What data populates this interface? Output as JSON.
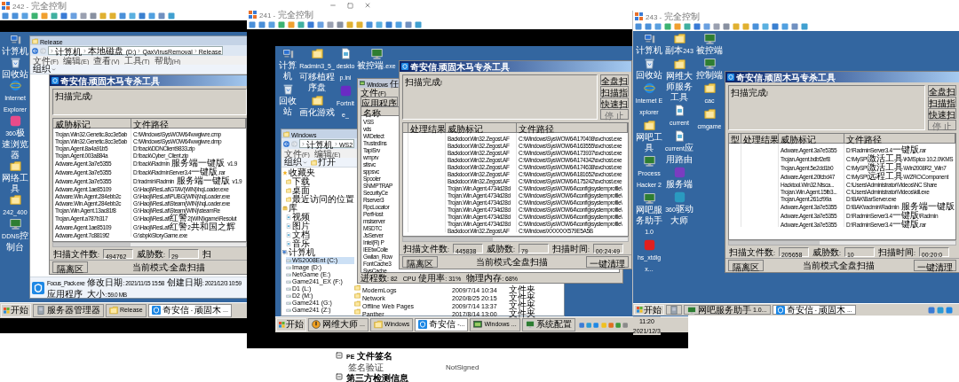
{
  "windows": [
    {
      "title": "242 - 完全控制",
      "desktop_icon_columns": [
        [
          {
            "kind": "computer",
            "label": "计算机"
          },
          {
            "kind": "recycle",
            "label": "回收站"
          },
          {
            "kind": "ie",
            "label": "Internet Explorer"
          },
          {
            "kind": "app",
            "color": "#e84b8a",
            "label": "360极速浏览器"
          },
          {
            "kind": "folder",
            "label": "网络工具"
          },
          {
            "kind": "folder",
            "label": "242_400"
          },
          {
            "kind": "monitor",
            "label": "DDNS控制台"
          }
        ]
      ],
      "explorer": {
        "title": "Release",
        "address": [
          "计算机",
          "本地磁盘 (D:)",
          "QaxVirusRemoval",
          "Release"
        ],
        "menu": [
          "文件(F)",
          "编辑(E)",
          "查看(V)",
          "工具(T)",
          "帮助(H)"
        ],
        "toolbar": [
          {
            "kind": "dropdown",
            "label": "组织"
          }
        ],
        "details": {
          "name": "Focus_Pack.exe",
          "type": "应用程序",
          "modified": "修改日期: 2021/11/15 15:58",
          "size": "大小: 59.0 MB",
          "created": "创建日期: 2021/12/3 10:59"
        }
      },
      "scanner": {
        "title": "奇安信-顽固木马专杀工具",
        "status": "扫描完成!",
        "columns": [
          "威胁标记",
          "文件路径"
        ],
        "rows": [
          {
            "threat": "Trojan.Win32.Genetic.8cc3e5ab",
            "path": "C:\\Windows\\SysWOW64\\vwgiwre.cmp"
          },
          {
            "threat": "Trojan.Win32.Genetic.8cc3e5ab",
            "path": "C:\\Windows\\SysWOW64\\vwgiwre.dmp"
          },
          {
            "threat": "Trojan.Agent.8a4a91b5",
            "path": "D:\\back\\DDNClient9833.zip"
          },
          {
            "threat": "Trojan.Agent.003a884a",
            "path": "D:\\back\\Cyber_Client.zip"
          },
          {
            "threat": "Adware.Agent.3a7e5355",
            "path": "D:\\back\\Radmin 服务端一键版 v1.9"
          },
          {
            "threat": "Adware.Agent.3a7e5355",
            "path": "D:\\back\\RadminServer3.4一键版.rar"
          },
          {
            "threat": "Adware.Agent.3a7e5355",
            "path": "D:\\radmin\\Radmin 服务端一键版 v1.9"
          },
          {
            "threat": "Adware.Agent.1ae85109",
            "path": "G:\\Haoji\\ResLat\\GTAV(WIN)\\hqLoader.exe"
          },
          {
            "threat": "Adware.Win.Agent.284ebb2c",
            "path": "G:\\Haoji\\ResLat\\PUBG(WIN)\\hqLoader.exe"
          },
          {
            "threat": "Adware.Win.Agent.284ebb2c",
            "path": "G:\\Haoji\\ResLat\\Steam(WIN)\\hqLoader.exe"
          },
          {
            "threat": "Trojan.Win.Agent.13ac81f8",
            "path": "G:\\Haoji\\ResLat\\Steam(WIN)\\steamRe"
          },
          {
            "threat": "Trojan.Agent.a787b317",
            "path": "G:\\Haoji\\ResLat\\红警2(WIN)\\game\\Resolut"
          },
          {
            "threat": "Adware.Agent.1ae85109",
            "path": "G:\\Haoji\\ResLat\\红警2共和国之辉"
          },
          {
            "threat": "Adware.Agent.7c8819f2",
            "path": "G:\\sbpk\\StoryGame.exe"
          }
        ],
        "stats": [
          {
            "label": "扫描文件数:",
            "value": "494762"
          },
          {
            "label": "威胁数:",
            "value": "29"
          },
          {
            "label": "扫"
          }
        ],
        "quarantine": "隔离区",
        "mode": "当前模式:全盘扫描"
      },
      "taskbar": {
        "start": "开始",
        "items": [
          {
            "kind": "server",
            "label": "服务器管理器",
            "selected": false
          },
          {
            "kind": "folder",
            "label": "Release",
            "selected": false
          },
          {
            "kind": "shield",
            "label": "奇安信-顽固木...",
            "selected": true
          }
        ]
      }
    },
    {
      "title": "241 - 完全控制",
      "desktop_icon_columns": [
        [
          {
            "kind": "computer",
            "label": "计算机"
          },
          {
            "kind": "recycle",
            "label": "回收站"
          }
        ],
        [
          {
            "kind": "folder",
            "label": "Radmin3_5_可移植程序盘"
          },
          {
            "kind": "folder",
            "label": "画化游戏"
          }
        ],
        [
          {
            "kind": "file",
            "label": "desktop.ini"
          },
          {
            "kind": "app",
            "color": "#6a2bc4",
            "label": "Fortnite_"
          }
        ],
        [
          {
            "kind": "monitor",
            "label": "被控端.exe"
          }
        ]
      ],
      "explorer": {
        "title": "Windows",
        "address": [
          "计算机",
          "WS2"
        ],
        "menu": [
          "文件(F)",
          "编辑(E)"
        ],
        "toolbar": [
          {
            "kind": "dropdown",
            "label": "组织"
          },
          {
            "kind": "open",
            "label": "打开"
          }
        ],
        "sidebar": [
          {
            "kind": "star",
            "label": "收藏夹",
            "selected": false,
            "children": [
              {
                "kind": "folder",
                "label": "下载",
                "selected": false
              },
              {
                "kind": "folder",
                "label": "桌面",
                "selected": false
              },
              {
                "kind": "folder",
                "label": "最近访问的位置",
                "selected": false
              }
            ]
          },
          {
            "kind": "library",
            "label": "库",
            "selected": false,
            "children": [
              {
                "kind": "file",
                "label": "视频",
                "selected": false
              },
              {
                "kind": "file",
                "label": "图片",
                "selected": false
              },
              {
                "kind": "file",
                "label": "文档",
                "selected": false
              },
              {
                "kind": "file",
                "label": "音乐",
                "selected": false
              }
            ]
          },
          {
            "kind": "computer",
            "label": "计算机",
            "selected": false,
            "children": [
              {
                "kind": "drive",
                "label": "WS2008Ent (C:)",
                "selected": true
              },
              {
                "kind": "drive",
                "label": "Image (D:)",
                "selected": false
              },
              {
                "kind": "drive",
                "label": "NetGame (E:)",
                "selected": false
              },
              {
                "kind": "drive",
                "label": "Game241_EX (F:)",
                "selected": false
              },
              {
                "kind": "drive",
                "label": "D1 (L:)",
                "selected": false
              },
              {
                "kind": "drive",
                "label": "D2 (M:)",
                "selected": false
              },
              {
                "kind": "drive",
                "label": "Game241 (G:)",
                "selected": false
              },
              {
                "kind": "drive",
                "label": "Game241 (Z:)",
                "selected": false
              }
            ]
          }
        ],
        "files": [
          {
            "name": "ModemLogs",
            "date": "2009/7/14 10:34",
            "type": "文件夹"
          },
          {
            "name": "Network",
            "date": "2020/8/25 20:15",
            "type": "文件夹"
          },
          {
            "name": "Offline Web Pages",
            "date": "2009/7/14 13:37",
            "type": "文件夹"
          },
          {
            "name": "Panther",
            "date": "2017/8/14 13:00",
            "type": "文件夹"
          }
        ]
      },
      "task_manager": {
        "title": "Windows 任",
        "menu": [
          "文件(F)"
        ],
        "tabs": [
          {
            "label": "应用程序",
            "selected": false
          }
        ],
        "column": "名称",
        "processes": [
          "VSS",
          "vds",
          "WIDetect",
          "TrustedIns",
          "TapiSrv",
          "wmprv",
          "stisvc",
          "sppsvc",
          "Spooler",
          "SNMPTRAP",
          "SecurityCe",
          "Rserver3",
          "RpcLocator",
          "PerfHost",
          "msiserver",
          "MSDTC",
          "JsServer",
          "Intel(R) P",
          "IEEtwColle",
          "Gwilan_Row",
          "FontCache3",
          "SysCache"
        ],
        "status": [
          "进程数: 82",
          "CPU 使用率: 31%",
          "物理内存: 68%"
        ]
      },
      "scanner": {
        "title": "奇安信-顽固木马专杀工具",
        "status": "扫描完成!",
        "side_buttons": [
          {
            "label": "全盘扫",
            "disabled": false
          },
          {
            "label": "扫描指",
            "disabled": false
          },
          {
            "label": "快速扫",
            "disabled": false
          },
          {
            "label": "停 止",
            "disabled": true
          }
        ],
        "columns": [
          "处理结果",
          "威胁标记",
          "文件路径"
        ],
        "rows": [
          {
            "threat": "Backdoor.Win32.Zegost.AF",
            "path": "C:\\Windows\\SysWOW64\\170408\\svchost.exe"
          },
          {
            "threat": "Backdoor.Win32.Zegost.AF",
            "path": "C:\\Windows\\SysWOW64\\163555\\svchost.exe"
          },
          {
            "threat": "Backdoor.Win32.Zegost.AF",
            "path": "C:\\Windows\\SysWOW64\\173937\\svchost.exe"
          },
          {
            "threat": "Backdoor.Win32.Zegost.AF",
            "path": "C:\\Windows\\SysWOW64\\174342\\svchost.exe"
          },
          {
            "threat": "Backdoor.Win32.Zegost.AF",
            "path": "C:\\Windows\\SysWOW64\\174638\\svchost.exe"
          },
          {
            "threat": "Backdoor.Win32.Zegost.AF",
            "path": "C:\\Windows\\SysWOW64\\181652\\svchost.exe"
          },
          {
            "threat": "Backdoor.Win32.Zegost.AF",
            "path": "C:\\Windows\\SysWOW64\\175242\\svchost.exe"
          },
          {
            "threat": "Trojan.Win.Agent.4734d28d",
            "path": "C:\\Windows\\SysWOW64\\config\\systemprofile\\"
          },
          {
            "threat": "Trojan.Win.Agent.4734d28d",
            "path": "C:\\Windows\\SysWOW64\\config\\systemprofile\\"
          },
          {
            "threat": "Trojan.Win.Agent.4734d28d",
            "path": "C:\\Windows\\SysWOW64\\config\\systemprofile\\"
          },
          {
            "threat": "Trojan.Win.Agent.4734d28d",
            "path": "C:\\Windows\\SysWOW64\\config\\systemprofile\\"
          },
          {
            "threat": "Trojan.Win.Agent.4734d28d",
            "path": "C:\\Windows\\SysWOW64\\config\\systemprofile\\"
          },
          {
            "threat": "Trojan.Win.Agent.4734d28d",
            "path": "C:\\Windows\\SysWOW64\\config\\systemprofile\\"
          },
          {
            "threat": "Backdoor.Win32.Zegost.AF",
            "path": "C:\\Windows\\XXXXXX579E5A5B"
          }
        ],
        "stats": [
          {
            "label": "扫描文件数:",
            "value": "445838"
          },
          {
            "label": "威胁数:",
            "value": "79"
          },
          {
            "label": "扫描时间:",
            "value": "00:24:49"
          }
        ],
        "quarantine": "隔离区",
        "mode": "当前模式:全盘扫描",
        "clean": "一键清理"
      },
      "taskbar": {
        "start": "开始",
        "items": [
          {
            "kind": "globe",
            "label": "网维大师...",
            "selected": false
          },
          {
            "kind": "folder",
            "label": "Windows",
            "selected": false
          },
          {
            "kind": "shield",
            "label": "奇安信-...",
            "selected": true
          },
          {
            "kind": "window",
            "label": "Windows ...",
            "selected": false
          },
          {
            "kind": "monitor",
            "label": "系统配置",
            "selected": false
          }
        ],
        "clock": {
          "time": "11:20",
          "date": "2021/12/3"
        }
      }
    },
    {
      "title": "243 - 完全控制",
      "desktop_icon_columns": [
        [
          {
            "kind": "computer",
            "label": "计算机"
          },
          {
            "kind": "recycle",
            "label": "回收站"
          },
          {
            "kind": "ie",
            "label": "Internet Explorer"
          },
          {
            "kind": "folder",
            "label": "网吧工具"
          },
          {
            "kind": "monitor",
            "label": "Process Hacker 2"
          },
          {
            "kind": "monitor",
            "label": "网吧服务助手1.0"
          },
          {
            "kind": "app",
            "color": "#e02020",
            "label": "hs_xtdlgx..."
          }
        ],
        [
          {
            "kind": "folder",
            "label": "副本243"
          },
          {
            "kind": "folder",
            "label": "网维大师服务工具"
          },
          {
            "kind": "file",
            "label": "current"
          },
          {
            "kind": "file",
            "label": "current应用路由"
          },
          {
            "kind": "app",
            "color": "#7a3cc0",
            "label": "服务端"
          },
          {
            "kind": "app",
            "color": "#2a9ac0",
            "label": "360驱动大师"
          }
        ],
        [
          {
            "kind": "monitor",
            "label": "被控端"
          },
          {
            "kind": "monitor",
            "label": "控制端"
          },
          {
            "kind": "folder",
            "label": "cac"
          },
          {
            "kind": "folder",
            "label": "cmgame"
          }
        ]
      ],
      "scanner": {
        "title": "奇安信-顽固木马专杀工具",
        "status": "扫描完成!",
        "side_buttons": [
          {
            "label": "全盘扫",
            "disabled": false
          },
          {
            "label": "扫描指",
            "disabled": false
          },
          {
            "label": "快速扫",
            "disabled": false
          },
          {
            "label": "停 止",
            "disabled": true
          }
        ],
        "columns": [
          "型",
          "处理结果",
          "威胁标记",
          "文件路径"
        ],
        "rows": [
          {
            "threat": "Adware.Agent.3a7e5355",
            "path": "D:\\RadminServer3.4一键版.rar"
          },
          {
            "threat": "Trojan.Agent.bdbf2ef8",
            "path": "C:\\MySP\\激活工具\\KMSpico 10.2.0\\KMS"
          },
          {
            "threat": "Trojan.Agent.5e2dd1b0",
            "path": "C:\\MySP\\激活工具\\Win2008R2_Win7"
          },
          {
            "threat": "Adware.Agent.20fcbd47",
            "path": "C:\\MySP\\远程工具\\WZRC\\Component"
          },
          {
            "threat": "Hacktool.Win32.Ntsca...",
            "path": "C:\\Users\\Administrator\\Videos\\NC Share"
          },
          {
            "threat": "Trojan.Win.Agent.15fb3...",
            "path": "C:\\Users\\Administrator\\Videos\\kill.exe"
          },
          {
            "threat": "Trojan.Agent.261cf99a",
            "path": "D:\\BAK\\BarServer.exe"
          },
          {
            "threat": "Adware.Agent.3a7e5355",
            "path": "D:\\BAK\\radmin\\Radmin 服务端一键版"
          },
          {
            "threat": "Adware.Agent.3a7e5355",
            "path": "D:\\RadminServer3.4一键版\\Radmin"
          },
          {
            "threat": "Adware.Agent.3a7e5355",
            "path": "D:\\RadminServer3.4一键版.rar"
          }
        ],
        "stats": [
          {
            "label": "扫描文件数:",
            "value": "205658"
          },
          {
            "label": "威胁数:",
            "value": "10"
          },
          {
            "label": "扫描时间:",
            "value": "00:20:0"
          }
        ],
        "quarantine": "隔离区",
        "mode": "当前模式:全盘扫描",
        "clean": "一键清理"
      },
      "taskbar": {
        "start": "开始",
        "items": [
          {
            "kind": "server",
            "selected": false
          },
          {
            "kind": "monitor",
            "label": "网吧服务助手1.0...",
            "selected": false
          },
          {
            "kind": "shield",
            "label": "奇安信-顽固木...",
            "selected": true
          }
        ]
      }
    }
  ],
  "detail_panel": {
    "items": [
      {
        "kind": "section",
        "label": "PE 文件签名"
      },
      {
        "kind": "field",
        "label": "签名验证",
        "value": "NotSigned"
      },
      {
        "kind": "section",
        "label": "第三方检测信息"
      }
    ]
  }
}
